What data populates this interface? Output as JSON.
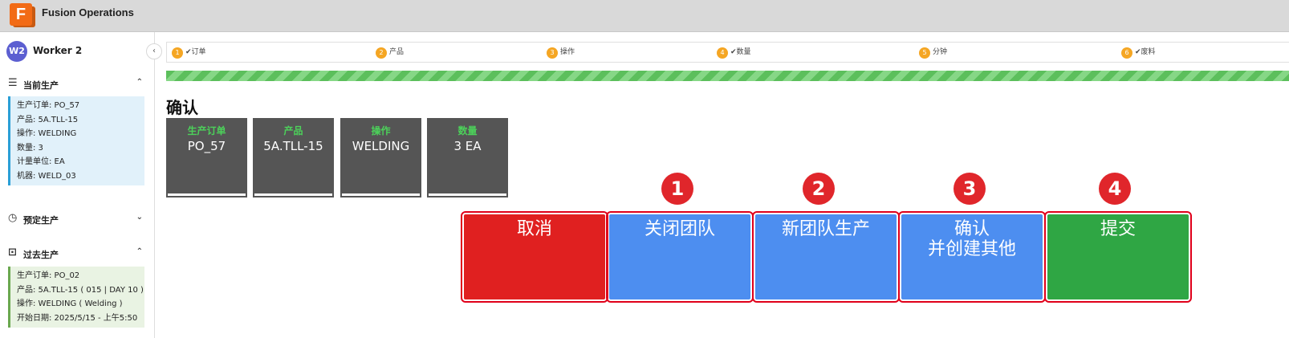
{
  "app": {
    "logo_letter": "F",
    "title": "Fusion Operations"
  },
  "user": {
    "initials": "W2",
    "name": "Worker 2"
  },
  "sidebar": {
    "current": {
      "title": "当前生产",
      "lines": [
        "生产订单: PO_57",
        "产品: 5A.TLL-15",
        "操作: WELDING",
        "数量: 3",
        "计量单位: EA",
        "机器: WELD_03"
      ]
    },
    "scheduled": {
      "title": "预定生产"
    },
    "past": {
      "title": "过去生产",
      "lines": [
        "生产订单: PO_02",
        "产品: 5A.TLL-15 ( 015 | DAY 10 )",
        "操作: WELDING ( Welding )",
        "开始日期: 2025/5/15 - 上午5:50"
      ]
    }
  },
  "steps": [
    {
      "num": "1",
      "label": "✔订单"
    },
    {
      "num": "2",
      "label": "产品"
    },
    {
      "num": "3",
      "label": "操作"
    },
    {
      "num": "4",
      "label": "✔数量"
    },
    {
      "num": "5",
      "label": "分钟"
    },
    {
      "num": "6",
      "label": "✔废料"
    }
  ],
  "page_title": "确认",
  "cards": [
    {
      "key": "生产订单",
      "value": "PO_57"
    },
    {
      "key": "产品",
      "value": "5A.TLL-15"
    },
    {
      "key": "操作",
      "value": "WELDING"
    },
    {
      "key": "数量",
      "value": "3 EA"
    }
  ],
  "actions": {
    "cancel": "取消",
    "close_team": "关闭团队",
    "new_team": "新团队生产",
    "confirm_line1": "确认",
    "confirm_line2": "并创建其他",
    "submit": "提交"
  },
  "badges": [
    "1",
    "2",
    "3",
    "4"
  ],
  "colors": {
    "cancel": "#e02020",
    "action": "#4d8ef0",
    "submit": "#2fa644",
    "highlight": "#e0001a",
    "badge": "#e0262b"
  }
}
